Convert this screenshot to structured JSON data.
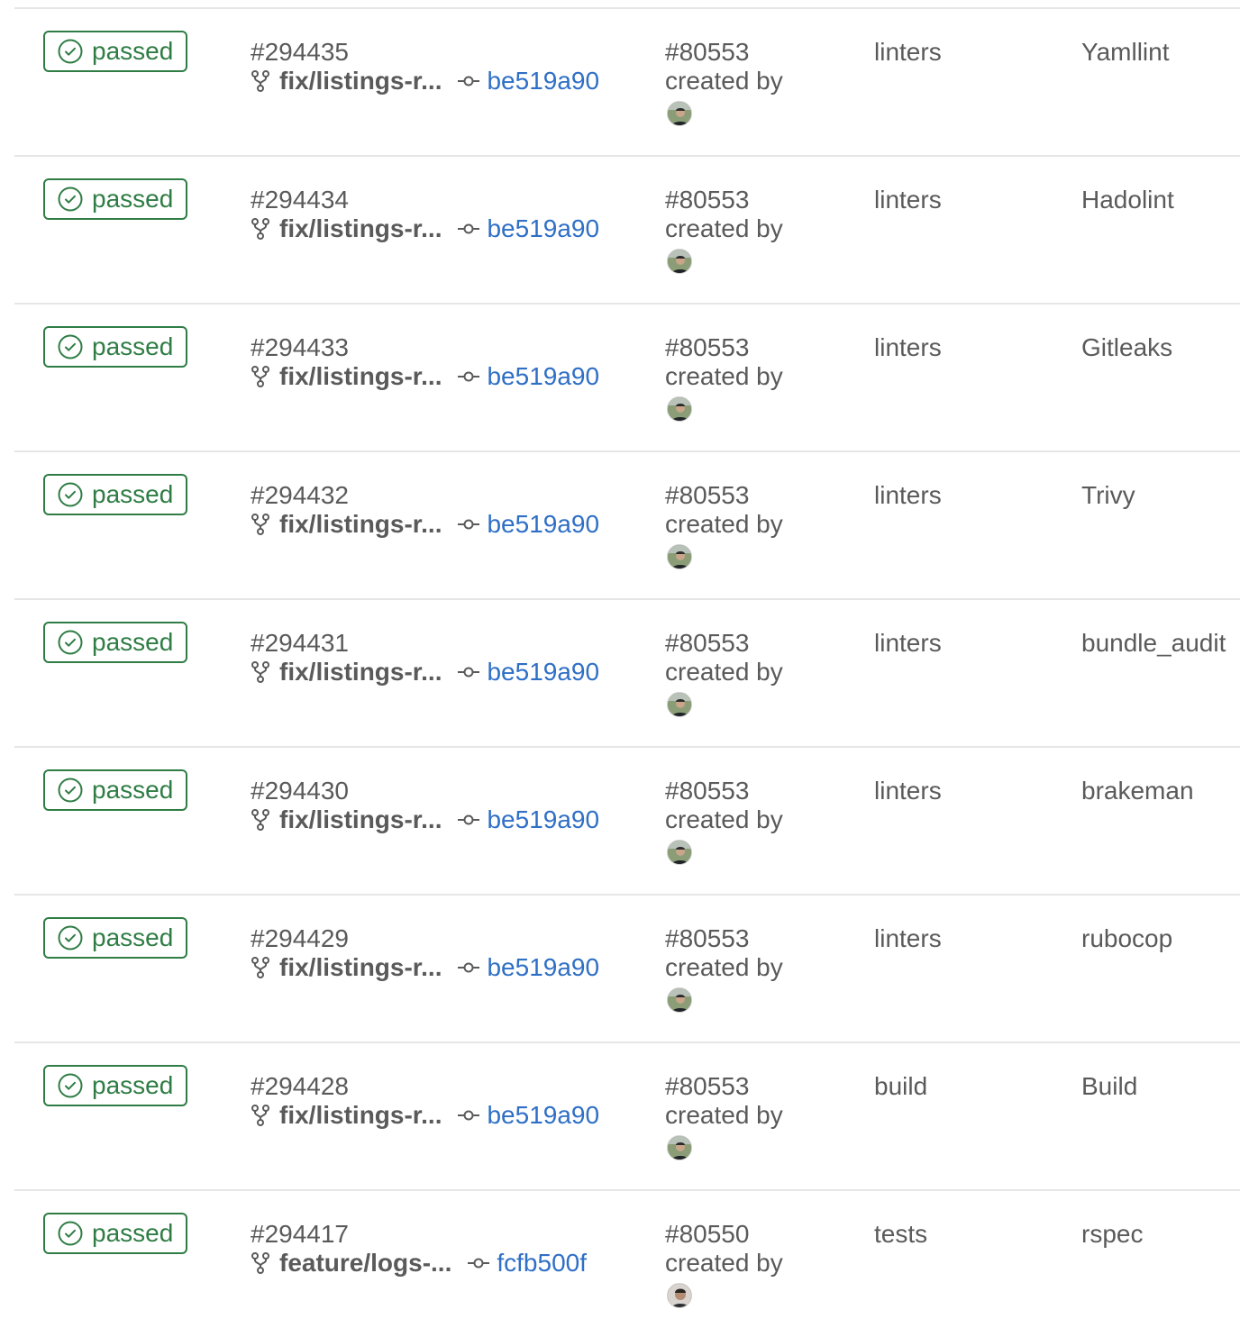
{
  "jobs": [
    {
      "status": "passed",
      "job_id": "#294435",
      "branch": "fix/listings-r...",
      "commit": "be519a90",
      "pipeline_id": "#80553",
      "created_by": "created by",
      "stage": "linters",
      "name": "Yamllint"
    },
    {
      "status": "passed",
      "job_id": "#294434",
      "branch": "fix/listings-r...",
      "commit": "be519a90",
      "pipeline_id": "#80553",
      "created_by": "created by",
      "stage": "linters",
      "name": "Hadolint"
    },
    {
      "status": "passed",
      "job_id": "#294433",
      "branch": "fix/listings-r...",
      "commit": "be519a90",
      "pipeline_id": "#80553",
      "created_by": "created by",
      "stage": "linters",
      "name": "Gitleaks"
    },
    {
      "status": "passed",
      "job_id": "#294432",
      "branch": "fix/listings-r...",
      "commit": "be519a90",
      "pipeline_id": "#80553",
      "created_by": "created by",
      "stage": "linters",
      "name": "Trivy"
    },
    {
      "status": "passed",
      "job_id": "#294431",
      "branch": "fix/listings-r...",
      "commit": "be519a90",
      "pipeline_id": "#80553",
      "created_by": "created by",
      "stage": "linters",
      "name": "bundle_audit"
    },
    {
      "status": "passed",
      "job_id": "#294430",
      "branch": "fix/listings-r...",
      "commit": "be519a90",
      "pipeline_id": "#80553",
      "created_by": "created by",
      "stage": "linters",
      "name": "brakeman"
    },
    {
      "status": "passed",
      "job_id": "#294429",
      "branch": "fix/listings-r...",
      "commit": "be519a90",
      "pipeline_id": "#80553",
      "created_by": "created by",
      "stage": "linters",
      "name": "rubocop"
    },
    {
      "status": "passed",
      "job_id": "#294428",
      "branch": "fix/listings-r...",
      "commit": "be519a90",
      "pipeline_id": "#80553",
      "created_by": "created by",
      "stage": "build",
      "name": "Build"
    },
    {
      "status": "passed",
      "job_id": "#294417",
      "branch": "feature/logs-...",
      "commit": "fcfb500f",
      "pipeline_id": "#80550",
      "created_by": "created by",
      "stage": "tests",
      "name": "rspec"
    }
  ],
  "icons": {
    "status": "check-circle-icon",
    "branch": "branch-icon",
    "commit": "commit-icon"
  },
  "colors": {
    "success": "#2f7d45",
    "link": "#2f6fc6",
    "text": "#5a5a5a",
    "divider": "#e6e6e6"
  }
}
